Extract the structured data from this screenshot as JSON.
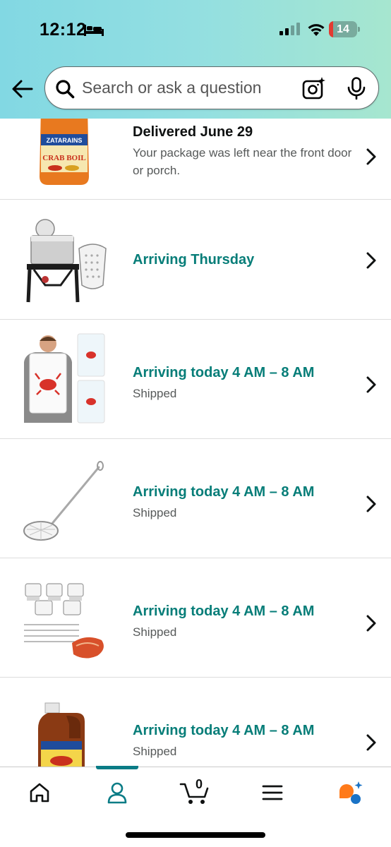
{
  "status_bar": {
    "time": "12:12",
    "battery_level": "14",
    "battery_percent": 14,
    "icons": [
      "sleep-icon",
      "signal-icon",
      "wifi-icon",
      "battery-icon"
    ]
  },
  "search": {
    "placeholder": "Search or ask a question",
    "value": "",
    "icons": [
      "back-arrow-icon",
      "search-icon",
      "camera-icon",
      "microphone-icon"
    ]
  },
  "orders": [
    {
      "image": "crab-boil-jar",
      "title": "Delivered June 29",
      "subtitle": "Your package was left near the front door or porch.",
      "status": "delivered"
    },
    {
      "image": "crawfish-boiler-kit",
      "title": "Arriving Thursday",
      "subtitle": "",
      "status": "arriving"
    },
    {
      "image": "crab-bib",
      "title": "Arriving today 4 AM – 8 AM",
      "subtitle": "Shipped",
      "status": "arriving"
    },
    {
      "image": "skimmer-ladle",
      "title": "Arriving today 4 AM – 8 AM",
      "subtitle": "Shipped",
      "status": "arriving"
    },
    {
      "image": "butter-warmers-crab-picks",
      "title": "Arriving today 4 AM – 8 AM",
      "subtitle": "Shipped",
      "status": "arriving"
    },
    {
      "image": "crab-boil-liquid-jug",
      "title": "Arriving today 4 AM – 8 AM",
      "subtitle": "Shipped",
      "status": "arriving"
    }
  ],
  "bottom_nav": {
    "items": [
      "home-icon",
      "account-icon",
      "cart-icon",
      "menu-icon",
      "rufus-icon"
    ],
    "active": "account-icon",
    "cart_count": "0"
  },
  "colors": {
    "accent_teal": "#067D78",
    "nav_indicator": "#0A7C86",
    "header_gradient_start": "#82D8E3",
    "header_gradient_end": "#A6E6CF",
    "battery_low": "#E23B32",
    "rufus_orange": "#FF7A1A",
    "rufus_blue": "#1A73C6"
  }
}
